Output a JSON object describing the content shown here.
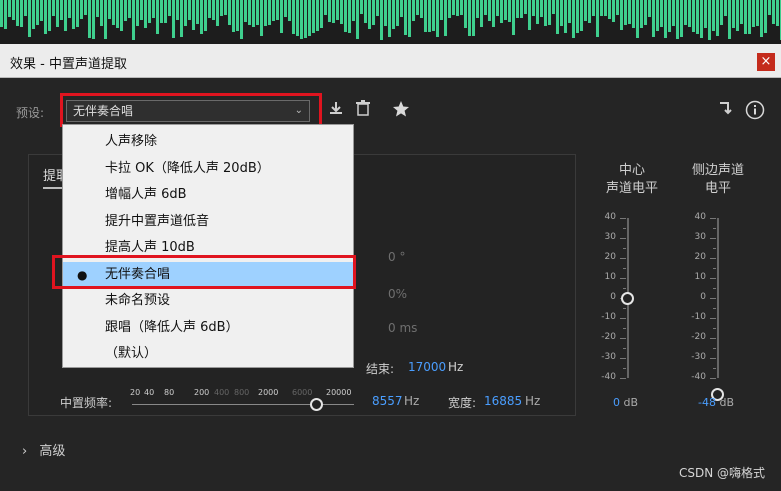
{
  "window": {
    "title": "效果 - 中置声道提取",
    "close_glyph": "×"
  },
  "toolbar": {
    "preset_label": "预设:",
    "preset_value": "无伴奏合唱",
    "chevron": "⌄",
    "icons": [
      "save-preset-icon",
      "delete-icon",
      "favorite-star-icon",
      "route-icon",
      "info-icon"
    ]
  },
  "dropdown": {
    "items": [
      {
        "label": "人声移除",
        "selected": false
      },
      {
        "label": "卡拉 OK（降低人声 20dB）",
        "selected": false
      },
      {
        "label": "增幅人声 6dB",
        "selected": false
      },
      {
        "label": "提升中置声道低音",
        "selected": false
      },
      {
        "label": "提高人声 10dB",
        "selected": false
      },
      {
        "label": "无伴奏合唱",
        "selected": true
      },
      {
        "label": "未命名预设",
        "selected": false
      },
      {
        "label": "跟唱（降低人声 6dB）",
        "selected": false
      },
      {
        "label": "（默认）",
        "selected": false
      }
    ],
    "bullet": "●"
  },
  "panel": {
    "tab_label": "提取",
    "ghost_values": [
      "0 °",
      "0%",
      "0 ms"
    ],
    "range_row": {
      "end_label": "结束:",
      "end_value": "17000",
      "end_unit": "Hz"
    },
    "center_row": {
      "label": "中置频率:",
      "scale_ticks": [
        "20",
        "40",
        "80",
        "200",
        "400",
        "800",
        "2000",
        "6000",
        "20000"
      ],
      "value": "8557",
      "unit": "Hz",
      "width_label": "宽度:",
      "width_value": "16885",
      "width_unit": "Hz"
    }
  },
  "meters": {
    "center": {
      "title_line1": "中心",
      "title_line2": "声道电平",
      "value": "0",
      "unit": "dB",
      "level_db": 0
    },
    "side": {
      "title_line1": "侧边声道",
      "title_line2": "电平",
      "value": "-48",
      "unit": "dB",
      "level_db": -48
    },
    "scale_labels": [
      "40",
      "30",
      "20",
      "10",
      "0",
      "-10",
      "-20",
      "-30",
      "-40"
    ]
  },
  "advanced": {
    "chevron": "›",
    "label": "高级"
  },
  "watermark": "CSDN @嗨格式",
  "colors": {
    "accent_blue": "#4a9eff",
    "highlight": "#e0141f",
    "selected_row": "#9ed1ff",
    "waveform": "#3fcf8e"
  }
}
